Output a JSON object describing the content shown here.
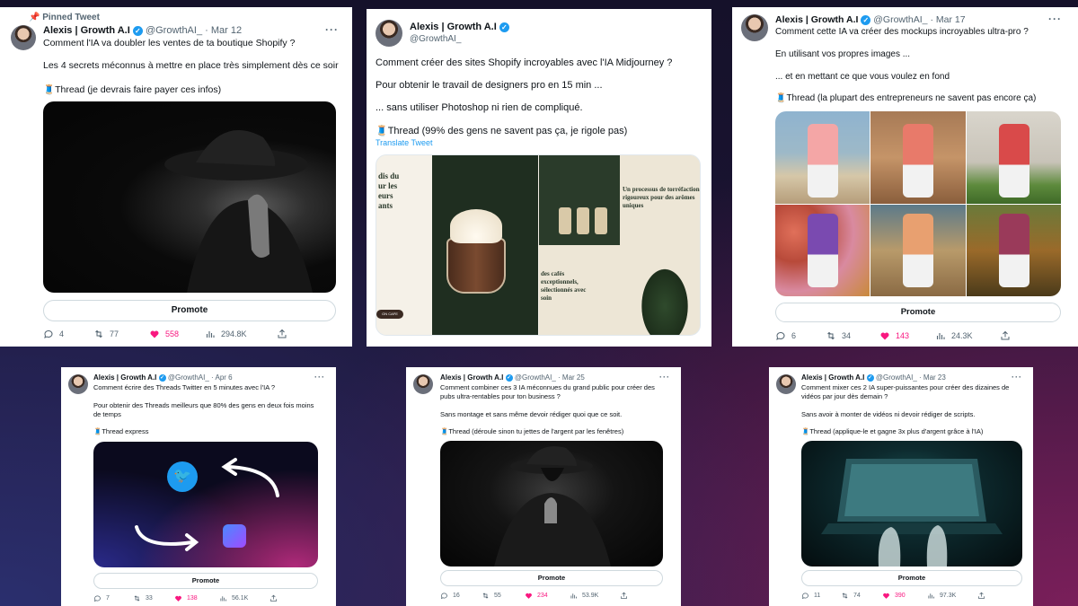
{
  "tweets": [
    {
      "id": "t1",
      "pinned": "Pinned Tweet",
      "name": "Alexis | Growth A.I",
      "handle": "@GrowthAI_",
      "date": "Mar 12",
      "lines": [
        "Comment l'IA va doubler les ventes de ta boutique Shopify ?",
        "Les 4 secrets méconnus à mettre en place très simplement dès ce soir",
        "🧵Thread (je devrais faire payer ces infos)"
      ],
      "promote": "Promote",
      "replies": "4",
      "retweets": "77",
      "likes": "558",
      "views": "294.8K"
    },
    {
      "id": "t2",
      "name": "Alexis | Growth A.I",
      "handle": "@GrowthAI_",
      "lines": [
        "Comment créer des sites Shopify incroyables avec l'IA Midjourney ?",
        "Pour obtenir le travail de designers pro en 15 min ...",
        "... sans utiliser Photoshop ni rien de compliqué.",
        "🧵Thread (99% des gens ne savent pas ça, je rigole pas)"
      ],
      "translate": "Translate Tweet",
      "mock": {
        "left_heading": "dis du ur les eurs ants",
        "button": "ON CAFE",
        "right_heading": "Un processus de torréfaction rigoureux pour des arômes uniques",
        "right_sub": "des cafés exceptionnels, sélectionnés avec soin"
      }
    },
    {
      "id": "t3",
      "name": "Alexis | Growth A.I",
      "handle": "@GrowthAI_",
      "date": "Mar 17",
      "lines": [
        "Comment cette IA va créer des mockups incroyables ultra-pro ?",
        "En utilisant vos propres images ...",
        "... et en mettant ce que vous voulez en fond",
        "🧵Thread (la plupart des entrepreneurs ne savent pas encore ça)"
      ],
      "promote": "Promote",
      "replies": "6",
      "retweets": "34",
      "likes": "143",
      "views": "24.3K"
    },
    {
      "id": "t4",
      "name": "Alexis | Growth A.I",
      "handle": "@GrowthAI_",
      "date": "Apr 6",
      "lines": [
        "Comment écrire des Threads Twitter en 5 minutes avec l'IA ?",
        "Pour obtenir des Threads meilleurs que 80% des gens en deux fois moins",
        "de temps",
        "🧵Thread express"
      ],
      "promote": "Promote",
      "replies": "7",
      "retweets": "33",
      "likes": "138",
      "views": "56.1K"
    },
    {
      "id": "t5",
      "name": "Alexis | Growth A.I",
      "handle": "@GrowthAI_",
      "date": "Mar 25",
      "lines": [
        "Comment combiner ces 3 IA méconnues du grand public pour créer des",
        "pubs ultra-rentables pour ton business ?",
        "Sans montage et sans même devoir rédiger quoi que ce soit.",
        "🧵Thread (déroule sinon tu jettes de l'argent par les fenêtres)"
      ],
      "promote": "Promote",
      "replies": "16",
      "retweets": "55",
      "likes": "234",
      "views": "53.9K"
    },
    {
      "id": "t6",
      "name": "Alexis | Growth A.I",
      "handle": "@GrowthAI_",
      "date": "Mar 23",
      "lines": [
        "Comment mixer ces 2 IA super-puissantes pour créer des dizaines de",
        "vidéos par jour dès demain ?",
        "Sans avoir à monter de vidéos ni devoir rédiger de scripts.",
        "🧵Thread (applique-le et gagne 3x plus d'argent grâce à l'IA)"
      ],
      "promote": "Promote",
      "replies": "11",
      "retweets": "74",
      "likes": "390",
      "views": "97.3K"
    }
  ],
  "colors": {
    "like": "#f91880",
    "verified": "#1d9bf0",
    "muted": "#536471"
  }
}
